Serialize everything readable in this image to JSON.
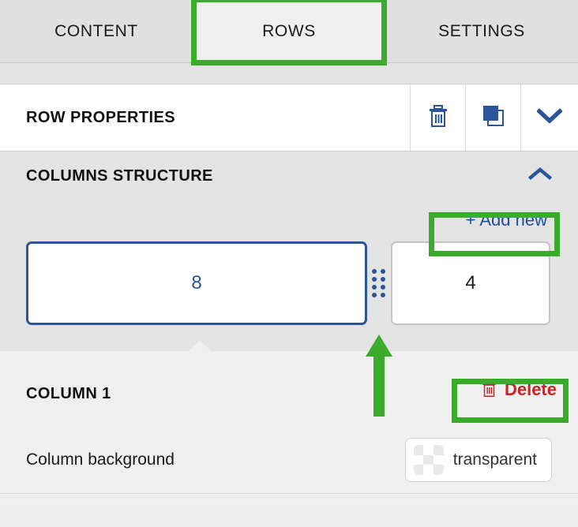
{
  "tabs": {
    "items": [
      {
        "id": "content",
        "label": "CONTENT",
        "active": false
      },
      {
        "id": "rows",
        "label": "ROWS",
        "active": true
      },
      {
        "id": "settings",
        "label": "SETTINGS",
        "active": false
      }
    ]
  },
  "row_properties": {
    "title": "ROW PROPERTIES",
    "actions": [
      {
        "id": "delete-row",
        "icon": "trash-icon"
      },
      {
        "id": "duplicate-row",
        "icon": "duplicate-icon"
      },
      {
        "id": "collapse-row",
        "icon": "chevron-down-icon"
      }
    ]
  },
  "columns_structure": {
    "title": "COLUMNS STRUCTURE",
    "collapse_icon": "chevron-up-icon",
    "add_new_label": "+ Add new",
    "columns": [
      {
        "id": "col-1",
        "value": "8",
        "selected": true
      },
      {
        "id": "col-2",
        "value": "4",
        "selected": false
      }
    ],
    "drag_handle_icon": "drag-dots-icon"
  },
  "column_detail": {
    "title": "COLUMN 1",
    "delete_label": "Delete",
    "delete_icon": "trash-icon",
    "background_label": "Column background",
    "background_value": "transparent",
    "background_swatch_icon": "checkerboard-swatch"
  },
  "annotations": {
    "highlight_color": "#3bab2c",
    "arrow_color": "#3bab2c",
    "highlighted": [
      "rows-tab",
      "add-new-button",
      "delete-button"
    ],
    "arrow_points_to": "column-drag-handle"
  },
  "colors": {
    "accent_blue": "#2a5599",
    "link_blue": "#1f4e9c",
    "danger_red": "#cc2222",
    "tabbar_bg": "#e0e0e0",
    "panel_bg": "#e3e3e3",
    "section_bg": "#efefef"
  }
}
